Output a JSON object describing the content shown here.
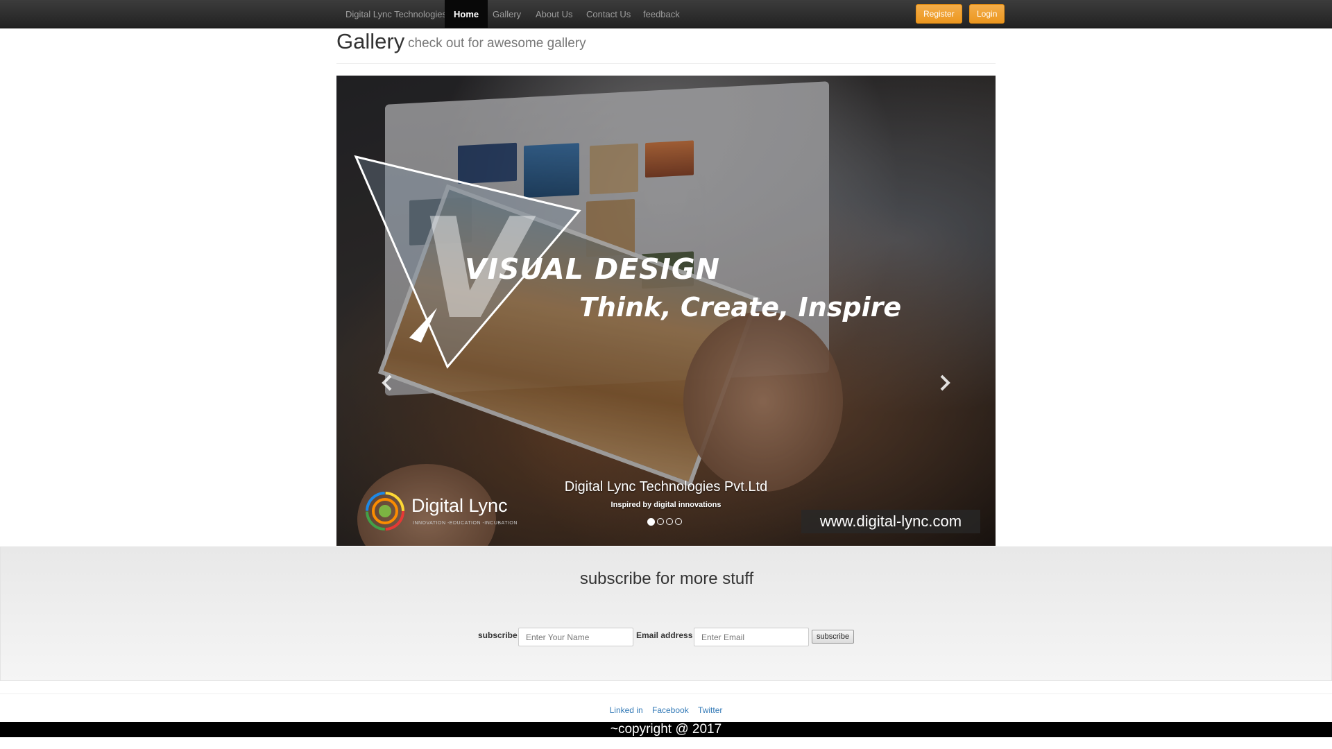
{
  "navbar": {
    "brand": "Digital Lync Technologies",
    "items": [
      {
        "label": "Home",
        "active": true
      },
      {
        "label": "Gallery",
        "active": false
      },
      {
        "label": "About Us",
        "active": false
      },
      {
        "label": "Contact Us",
        "active": false
      },
      {
        "label": "feedback",
        "active": false
      }
    ],
    "register_label": "Register",
    "login_label": "Login",
    "accent_color": "#f0ad4e"
  },
  "header": {
    "title": "Gallery",
    "subtitle": "check out for awesome gallery"
  },
  "carousel": {
    "slide_title": "VISUAL DESIGN",
    "slide_tagline": "Think, Create, Inspire",
    "logo_name": "Digital Lync",
    "logo_sub": "INNOVATION -EDUCATION -INCUBATION",
    "website": "www.digital-lync.com",
    "caption_title": "Digital Lync Technologies Pvt.Ltd",
    "caption_sub": "Inspired by digital innovations",
    "indicator_count": 4,
    "active_indicator": 0,
    "prev_icon": "chevron-left-icon",
    "next_icon": "chevron-right-icon"
  },
  "subscribe": {
    "title": "subscribe for more stuff",
    "name_label": "subscribe",
    "name_placeholder": "Enter Your Name",
    "email_label": "Email address",
    "email_placeholder": "Enter Email",
    "button_label": "subscribe"
  },
  "footer": {
    "links": [
      "Linked in",
      "Facebook",
      "Twitter"
    ],
    "copyright": "~copyright @ 2017"
  }
}
